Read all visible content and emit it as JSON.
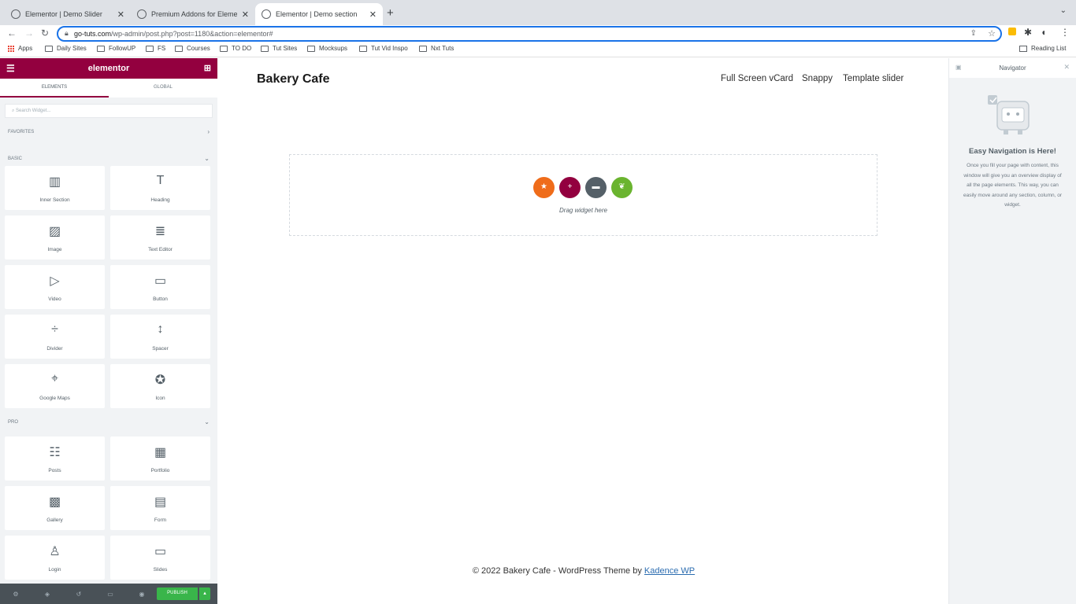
{
  "browser": {
    "tabs": [
      {
        "title": "Elementor | Demo Slider"
      },
      {
        "title": "Premium Addons for Elementor"
      },
      {
        "title": "Elementor | Demo section"
      }
    ],
    "url_host": "go-tuts.com",
    "url_path": "/wp-admin/post.php?post=1180&action=elementor#",
    "bookmarks": [
      "Apps",
      "Daily Sites",
      "FollowUP",
      "FS",
      "Courses",
      "TO DO",
      "Tut Sites",
      "Mocksups",
      "Tut Vid Inspo",
      "Nxt Tuts"
    ],
    "reading_list": "Reading List"
  },
  "panel": {
    "logo": "elementor",
    "tabs": [
      "ELEMENTS",
      "GLOBAL"
    ],
    "search_placeholder": "Search Widget...",
    "sections": {
      "favorites": "FAVORITES",
      "basic": "BASIC",
      "pro": "PRO"
    },
    "basic_widgets": [
      {
        "label": "Inner Section",
        "icon": "inner-section-icon"
      },
      {
        "label": "Heading",
        "icon": "heading-icon"
      },
      {
        "label": "Image",
        "icon": "image-icon"
      },
      {
        "label": "Text Editor",
        "icon": "text-editor-icon"
      },
      {
        "label": "Video",
        "icon": "video-icon"
      },
      {
        "label": "Button",
        "icon": "button-icon"
      },
      {
        "label": "Divider",
        "icon": "divider-icon"
      },
      {
        "label": "Spacer",
        "icon": "spacer-icon"
      },
      {
        "label": "Google Maps",
        "icon": "google-maps-icon"
      },
      {
        "label": "Icon",
        "icon": "star-icon"
      }
    ],
    "pro_widgets": [
      {
        "label": "Posts",
        "icon": "posts-icon"
      },
      {
        "label": "Portfolio",
        "icon": "portfolio-icon"
      },
      {
        "label": "Gallery",
        "icon": "gallery-icon"
      },
      {
        "label": "Form",
        "icon": "form-icon"
      },
      {
        "label": "Login",
        "icon": "login-icon"
      },
      {
        "label": "Slides",
        "icon": "slides-icon"
      }
    ],
    "publish_label": "PUBLISH"
  },
  "site": {
    "title": "Bakery Cafe",
    "menu": [
      "Full Screen vCard",
      "Snappy",
      "Template slider"
    ],
    "drag_text": "Drag widget here",
    "footer_prefix": "© 2022 Bakery Cafe - WordPress Theme by ",
    "footer_link": "Kadence WP"
  },
  "navigator": {
    "title": "Navigator",
    "heading": "Easy Navigation is Here!",
    "description": "Once you fill your page with content, this window will give you an overview display of all the page elements. This way, you can easily move around any section, column, or widget."
  },
  "colors": {
    "accent": "#93003f",
    "publish": "#39b54a"
  }
}
